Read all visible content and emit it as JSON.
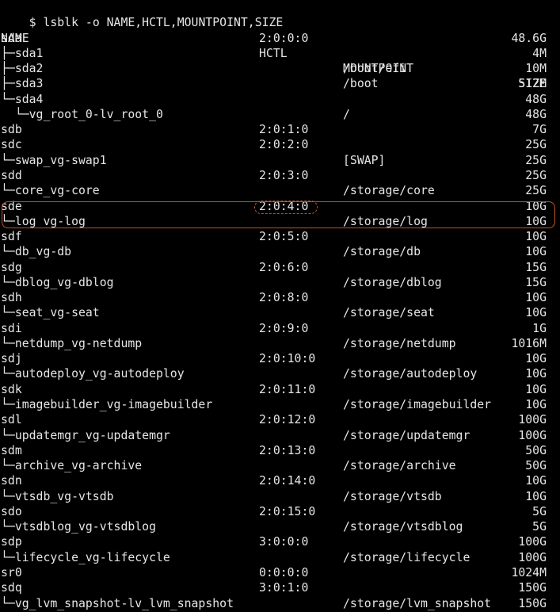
{
  "terminal": {
    "background": "#000000",
    "foreground": "#e6e6e6",
    "command": "$ lsblk -o NAME,HCTL,MOUNTPOINT,SIZE",
    "header": {
      "name": "NAME",
      "hctl": "HCTL",
      "mountpoint": "MOUNTPOINT",
      "size": "SIZE"
    },
    "rows": [
      {
        "name": "sda",
        "hctl": "2:0:0:0",
        "mountpoint": "",
        "size": "48.6G"
      },
      {
        "name": "├─sda1",
        "hctl": "",
        "mountpoint": "",
        "size": "4M"
      },
      {
        "name": "├─sda2",
        "hctl": "",
        "mountpoint": "/boot/efi",
        "size": "10M"
      },
      {
        "name": "├─sda3",
        "hctl": "",
        "mountpoint": "/boot",
        "size": "512M"
      },
      {
        "name": "└─sda4",
        "hctl": "",
        "mountpoint": "",
        "size": "48G"
      },
      {
        "name": "  └─vg_root_0-lv_root_0",
        "hctl": "",
        "mountpoint": "/",
        "size": "48G"
      },
      {
        "name": "sdb",
        "hctl": "2:0:1:0",
        "mountpoint": "",
        "size": "7G"
      },
      {
        "name": "sdc",
        "hctl": "2:0:2:0",
        "mountpoint": "",
        "size": "25G"
      },
      {
        "name": "└─swap_vg-swap1",
        "hctl": "",
        "mountpoint": "[SWAP]",
        "size": "25G"
      },
      {
        "name": "sdd",
        "hctl": "2:0:3:0",
        "mountpoint": "",
        "size": "25G"
      },
      {
        "name": "└─core_vg-core",
        "hctl": "",
        "mountpoint": "/storage/core",
        "size": "25G"
      },
      {
        "name": "sde",
        "hctl": "2:0:4:0",
        "mountpoint": "",
        "size": "10G"
      },
      {
        "name": "└─log_vg-log",
        "hctl": "",
        "mountpoint": "/storage/log",
        "size": "10G"
      },
      {
        "name": "sdf",
        "hctl": "2:0:5:0",
        "mountpoint": "",
        "size": "10G"
      },
      {
        "name": "└─db_vg-db",
        "hctl": "",
        "mountpoint": "/storage/db",
        "size": "10G"
      },
      {
        "name": "sdg",
        "hctl": "2:0:6:0",
        "mountpoint": "",
        "size": "15G"
      },
      {
        "name": "└─dblog_vg-dblog",
        "hctl": "",
        "mountpoint": "/storage/dblog",
        "size": "15G"
      },
      {
        "name": "sdh",
        "hctl": "2:0:8:0",
        "mountpoint": "",
        "size": "10G"
      },
      {
        "name": "└─seat_vg-seat",
        "hctl": "",
        "mountpoint": "/storage/seat",
        "size": "10G"
      },
      {
        "name": "sdi",
        "hctl": "2:0:9:0",
        "mountpoint": "",
        "size": "1G"
      },
      {
        "name": "└─netdump_vg-netdump",
        "hctl": "",
        "mountpoint": "/storage/netdump",
        "size": "1016M"
      },
      {
        "name": "sdj",
        "hctl": "2:0:10:0",
        "mountpoint": "",
        "size": "10G"
      },
      {
        "name": "└─autodeploy_vg-autodeploy",
        "hctl": "",
        "mountpoint": "/storage/autodeploy",
        "size": "10G"
      },
      {
        "name": "sdk",
        "hctl": "2:0:11:0",
        "mountpoint": "",
        "size": "10G"
      },
      {
        "name": "└─imagebuilder_vg-imagebuilder",
        "hctl": "",
        "mountpoint": "/storage/imagebuilder",
        "size": "10G"
      },
      {
        "name": "sdl",
        "hctl": "2:0:12:0",
        "mountpoint": "",
        "size": "100G"
      },
      {
        "name": "└─updatemgr_vg-updatemgr",
        "hctl": "",
        "mountpoint": "/storage/updatemgr",
        "size": "100G"
      },
      {
        "name": "sdm",
        "hctl": "2:0:13:0",
        "mountpoint": "",
        "size": "50G"
      },
      {
        "name": "└─archive_vg-archive",
        "hctl": "",
        "mountpoint": "/storage/archive",
        "size": "50G"
      },
      {
        "name": "sdn",
        "hctl": "2:0:14:0",
        "mountpoint": "",
        "size": "10G"
      },
      {
        "name": "└─vtsdb_vg-vtsdb",
        "hctl": "",
        "mountpoint": "/storage/vtsdb",
        "size": "10G"
      },
      {
        "name": "sdo",
        "hctl": "2:0:15:0",
        "mountpoint": "",
        "size": "5G"
      },
      {
        "name": "└─vtsdblog_vg-vtsdblog",
        "hctl": "",
        "mountpoint": "/storage/vtsdblog",
        "size": "5G"
      },
      {
        "name": "sdp",
        "hctl": "3:0:0:0",
        "mountpoint": "",
        "size": "100G"
      },
      {
        "name": "└─lifecycle_vg-lifecycle",
        "hctl": "",
        "mountpoint": "/storage/lifecycle",
        "size": "100G"
      },
      {
        "name": "sr0",
        "hctl": "0:0:0:0",
        "mountpoint": "",
        "size": "1024M"
      },
      {
        "name": "sdq",
        "hctl": "3:0:1:0",
        "mountpoint": "",
        "size": "150G"
      },
      {
        "name": "└─vg_lvm_snapshot-lv_lvm_snapshot",
        "hctl": "",
        "mountpoint": "/storage/lvm_snapshot",
        "size": "150G"
      }
    ]
  },
  "annotations": {
    "highlight_color": "#c0542a",
    "highlight_rows": [
      "sde",
      "└─log_vg-log"
    ],
    "circled_value": "2:0:4:0"
  }
}
